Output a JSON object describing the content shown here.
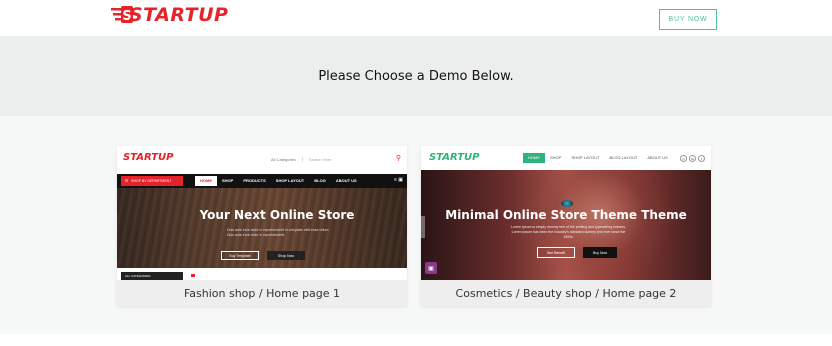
{
  "header": {
    "logo_text": "STARTUP",
    "buy_label": "BUY NOW"
  },
  "banner": {
    "title": "Please Choose a Demo Below."
  },
  "demos": [
    {
      "caption": "Fashion shop / Home page 1",
      "preview": {
        "logo": "STARTUP",
        "search_category": "All Categories",
        "search_placeholder": "Search Here",
        "department_label": "SHOP BY DEPARTMENT",
        "menu": [
          "HOME",
          "SHOP",
          "PRODUCTS",
          "SHOP LAYOUT",
          "BLOG",
          "ABOUT US"
        ],
        "hero_title": "Your Next Online Store",
        "hero_sub": "Duis aute irure dolor in reprehenderit in voluptate velit esse cillum. Duis aute irure dolor in reprehenderit.",
        "btn_a": "Buy Template",
        "btn_b": "Shop Now",
        "all_categories": "ALL CATEGORIES"
      }
    },
    {
      "caption": "Cosmetics / Beauty shop / Home page 2",
      "preview": {
        "logo": "STARTUP",
        "menu": [
          "HOME",
          "SHOP",
          "SHOP LAYOUT",
          "BLOG LAYOUT",
          "ABOUT US"
        ],
        "social": [
          "in",
          "tw",
          "f"
        ],
        "hero_title": "Minimal Online Store Theme Theme",
        "hero_sub": "Lorem Ipsum is simply dummy text of the printing and typesetting industry. Lorem Ipsum has been the industry's standard dummy text ever since the 1500s.",
        "btn_a": "See Benefit",
        "btn_b": "Buy Now"
      }
    }
  ],
  "colors": {
    "brand_red": "#e5232a",
    "accent_green": "#4cc19a",
    "banner_bg": "#eceeed"
  }
}
